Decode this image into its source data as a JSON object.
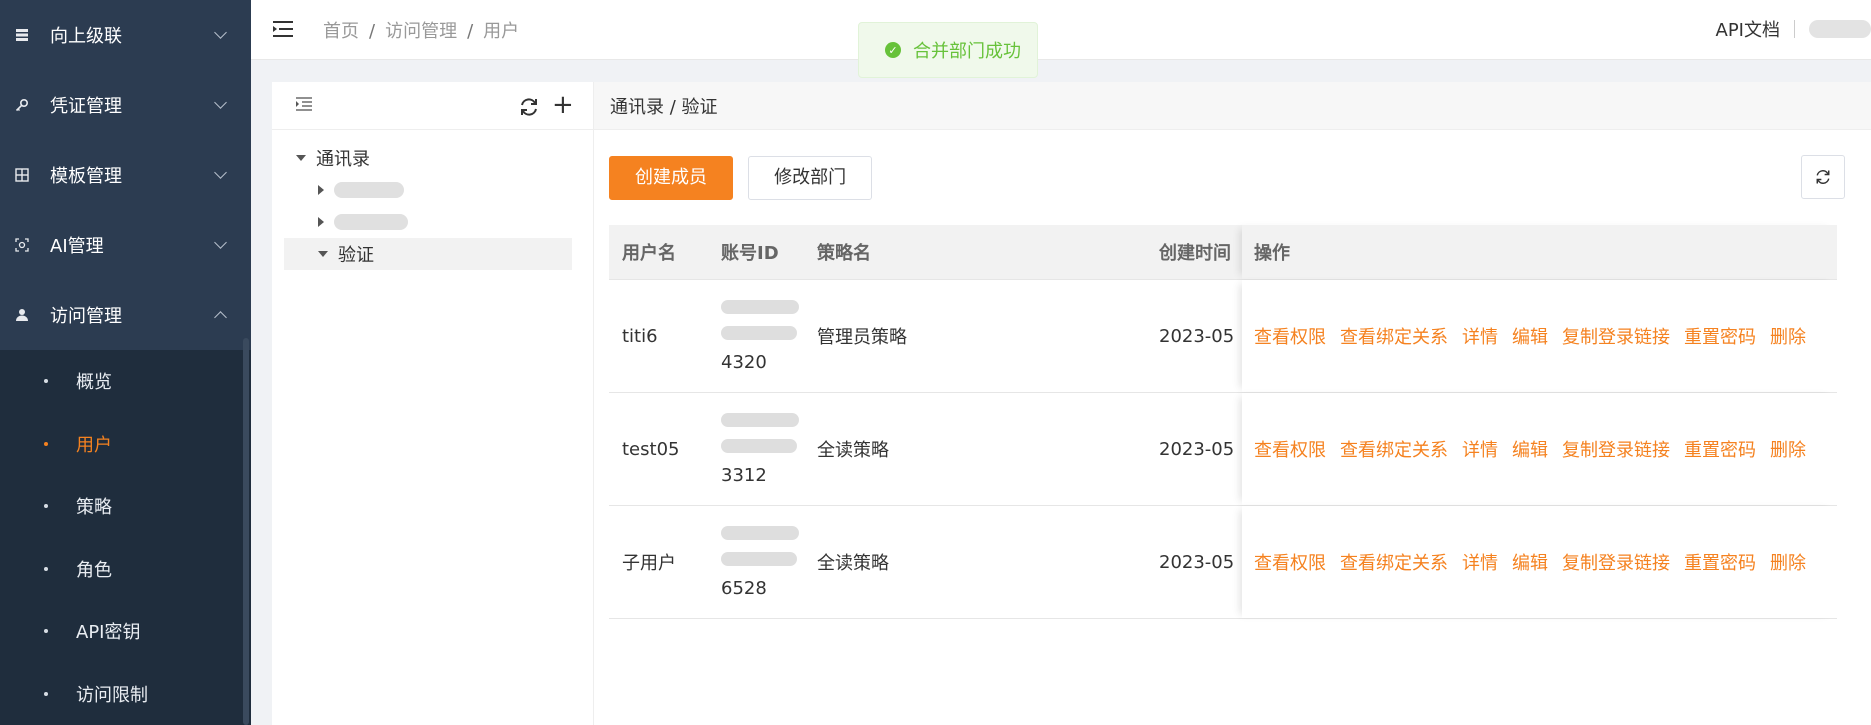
{
  "sidebar": {
    "menus": [
      {
        "label": "向上级联",
        "icon": "server-icon",
        "expanded": false
      },
      {
        "label": "凭证管理",
        "icon": "key-icon",
        "expanded": false
      },
      {
        "label": "模板管理",
        "icon": "grid-icon",
        "expanded": false
      },
      {
        "label": "AI管理",
        "icon": "ai-icon",
        "expanded": false
      },
      {
        "label": "访问管理",
        "icon": "user-icon",
        "expanded": true
      }
    ],
    "submenu": [
      {
        "label": "概览",
        "active": false
      },
      {
        "label": "用户",
        "active": true
      },
      {
        "label": "策略",
        "active": false
      },
      {
        "label": "角色",
        "active": false
      },
      {
        "label": "API密钥",
        "active": false
      },
      {
        "label": "访问限制",
        "active": false
      }
    ]
  },
  "header": {
    "breadcrumb": [
      "首页",
      "访问管理",
      "用户"
    ],
    "api_docs": "API文档"
  },
  "toast": {
    "message": "合并部门成功",
    "color": "#67c23a"
  },
  "tree": {
    "root": "通讯录",
    "selected": "验证"
  },
  "main": {
    "title": "通讯录 / 验证",
    "create_button": "创建成员",
    "edit_dept_button": "修改部门",
    "accent_color": "#f58220"
  },
  "table": {
    "headers": {
      "user": "用户名",
      "id": "账号ID",
      "policy": "策略名",
      "time": "创建时间",
      "ops": "操作"
    },
    "actions": [
      "查看权限",
      "查看绑定关系",
      "详情",
      "编辑",
      "复制登录链接",
      "重置密码",
      "删除"
    ],
    "rows": [
      {
        "user": "titi6",
        "id_suffix": "4320",
        "policy": "管理员策略",
        "time": "2023-05"
      },
      {
        "user": "test05",
        "id_suffix": "3312",
        "policy": "全读策略",
        "time": "2023-05"
      },
      {
        "user": "子用户",
        "id_suffix": "6528",
        "policy": "全读策略",
        "time": "2023-05"
      }
    ]
  }
}
